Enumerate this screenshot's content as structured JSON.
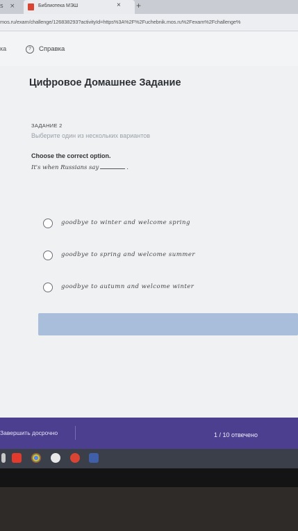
{
  "browser": {
    "prev_tab_fragment": "s",
    "prev_tab_close": "×",
    "active_tab_title": "Библиотека МЭШ",
    "tab_close": "×",
    "new_tab": "+",
    "url": "mos.ru/exam/challenge/126838293?activityId=https%3A%2F%2Fuchebnik.mos.ru%2Fexam%2Fchallenge%"
  },
  "topnav": {
    "left_fragment": "ка",
    "help_icon": "?",
    "help_label": "Справка"
  },
  "page": {
    "title": "Цифровое Домашнее Задание",
    "task_label": "ЗАДАНИЕ 2",
    "task_hint": "Выберите один из нескольких вариантов",
    "instruction": "Choose the correct option.",
    "question": "It's when Russians say",
    "question_end": "."
  },
  "options": [
    {
      "label": "goodbye to winter and welcome spring"
    },
    {
      "label": "goodbye to spring and welcome summer"
    },
    {
      "label": "goodbye to autumn and welcome winter"
    }
  ],
  "footer": {
    "finish_label": "Завершить досрочно",
    "progress": "1 / 10 отвечено"
  },
  "colors": {
    "footer_bg": "#4d3f8f",
    "button_bg": "#a8bedb",
    "page_bg": "#f0f1f3"
  }
}
